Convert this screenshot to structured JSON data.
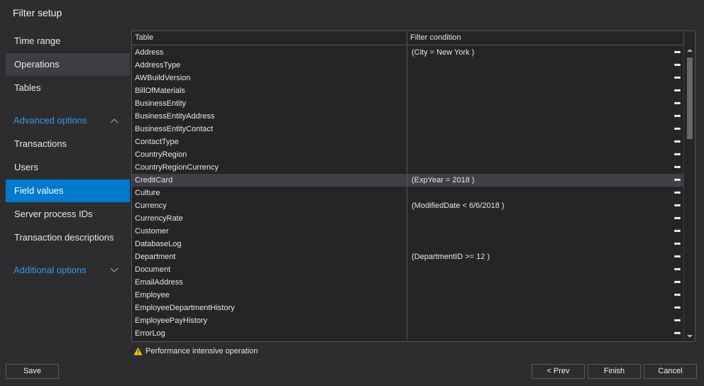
{
  "title": "Filter setup",
  "sidebar": {
    "items_top": [
      {
        "label": "Time range"
      },
      {
        "label": "Operations"
      },
      {
        "label": "Tables"
      }
    ],
    "advanced": {
      "label": "Advanced options",
      "items": [
        {
          "label": "Transactions"
        },
        {
          "label": "Users"
        },
        {
          "label": "Field values"
        },
        {
          "label": "Server process IDs"
        },
        {
          "label": "Transaction descriptions"
        }
      ]
    },
    "additional": {
      "label": "Additional options"
    },
    "hover_item": "Operations",
    "active_item": "Field values"
  },
  "grid": {
    "columns": [
      "Table",
      "Filter condition"
    ],
    "ellipsis": "•••",
    "selected_row": "CreditCard",
    "rows": [
      {
        "table": "Address",
        "filter": "(City = New York )"
      },
      {
        "table": "AddressType",
        "filter": ""
      },
      {
        "table": "AWBuildVersion",
        "filter": ""
      },
      {
        "table": "BillOfMaterials",
        "filter": ""
      },
      {
        "table": "BusinessEntity",
        "filter": ""
      },
      {
        "table": "BusinessEntityAddress",
        "filter": ""
      },
      {
        "table": "BusinessEntityContact",
        "filter": ""
      },
      {
        "table": "ContactType",
        "filter": ""
      },
      {
        "table": "CountryRegion",
        "filter": ""
      },
      {
        "table": "CountryRegionCurrency",
        "filter": ""
      },
      {
        "table": "CreditCard",
        "filter": "(ExpYear = 2018 )"
      },
      {
        "table": "Culture",
        "filter": ""
      },
      {
        "table": "Currency",
        "filter": "(ModifiedDate < 6/6/2018 )"
      },
      {
        "table": "CurrencyRate",
        "filter": ""
      },
      {
        "table": "Customer",
        "filter": ""
      },
      {
        "table": "DatabaseLog",
        "filter": ""
      },
      {
        "table": "Department",
        "filter": "(DepartmentID >= 12 )"
      },
      {
        "table": "Document",
        "filter": ""
      },
      {
        "table": "EmailAddress",
        "filter": ""
      },
      {
        "table": "Employee",
        "filter": ""
      },
      {
        "table": "EmployeeDepartmentHistory",
        "filter": ""
      },
      {
        "table": "EmployeePayHistory",
        "filter": ""
      },
      {
        "table": "ErrorLog",
        "filter": ""
      }
    ]
  },
  "warning": {
    "text": "Performance intensive operation",
    "icon": "warning-triangle-icon",
    "color": "#f5c518"
  },
  "buttons": {
    "save": "Save",
    "prev": "< Prev",
    "finish": "Finish",
    "cancel": "Cancel"
  },
  "colors": {
    "accent": "#007acc",
    "section": "#3794e6",
    "background": "#2d2d30"
  }
}
